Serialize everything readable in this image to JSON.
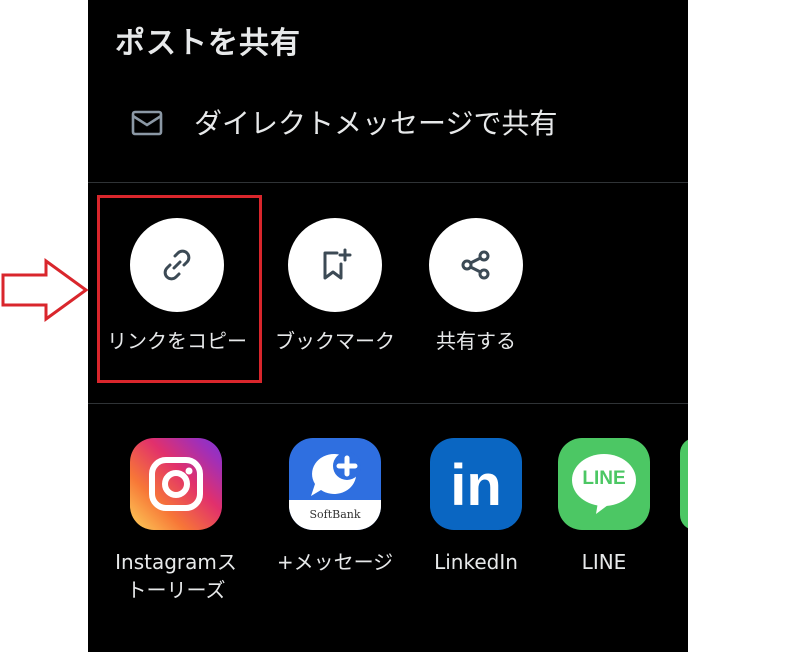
{
  "sheet": {
    "title": "ポストを共有",
    "dm_label": "ダイレクトメッセージで共有"
  },
  "actions": [
    {
      "label": "リンクをコピー",
      "icon": "link-icon"
    },
    {
      "label": "ブックマーク",
      "icon": "bookmark-plus-icon"
    },
    {
      "label": "共有する",
      "icon": "share-icon"
    }
  ],
  "apps": [
    {
      "label": "Instagramストーリーズ",
      "icon": "instagram-icon"
    },
    {
      "label": "+メッセージ",
      "icon": "plus-message-icon",
      "badge": "SoftBank"
    },
    {
      "label": "LinkedIn",
      "icon": "linkedin-icon",
      "tile_text": "in"
    },
    {
      "label": "LINE",
      "icon": "line-icon",
      "tile_text": "LINE"
    }
  ],
  "colors": {
    "highlight": "#d9262c",
    "sheet_bg": "#000000",
    "text": "#e7e9ea",
    "linkedin": "#0a66c2",
    "line": "#4cc764"
  }
}
